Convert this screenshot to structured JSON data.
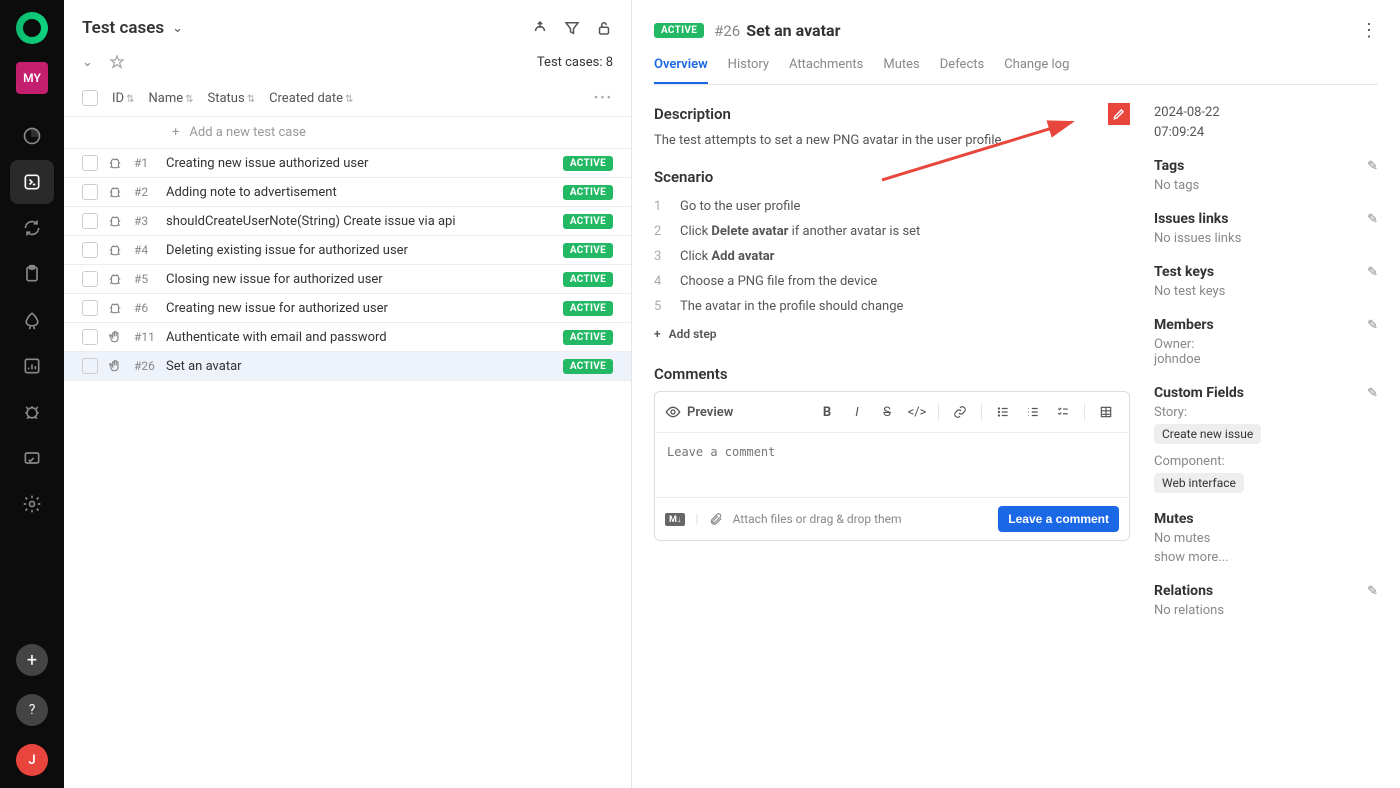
{
  "sidebar": {
    "my_badge": "MY",
    "user_initial": "J"
  },
  "left": {
    "title": "Test cases",
    "count_label": "Test cases: 8",
    "columns": {
      "id": "ID",
      "name": "Name",
      "status": "Status",
      "created": "Created date"
    },
    "add_placeholder": "Add a new test case",
    "rows": [
      {
        "id": "#1",
        "name": "Creating new issue authorized user",
        "status": "ACTIVE",
        "icon": "bug"
      },
      {
        "id": "#2",
        "name": "Adding note to advertisement",
        "status": "ACTIVE",
        "icon": "bug"
      },
      {
        "id": "#3",
        "name": "shouldCreateUserNote(String) Create issue via api",
        "status": "ACTIVE",
        "icon": "bug"
      },
      {
        "id": "#4",
        "name": "Deleting existing issue for authorized user",
        "status": "ACTIVE",
        "icon": "bug"
      },
      {
        "id": "#5",
        "name": "Closing new issue for authorized user",
        "status": "ACTIVE",
        "icon": "bug"
      },
      {
        "id": "#6",
        "name": "Creating new issue for authorized user",
        "status": "ACTIVE",
        "icon": "bug"
      },
      {
        "id": "#11",
        "name": "Authenticate with email and password",
        "status": "ACTIVE",
        "icon": "hand"
      },
      {
        "id": "#26",
        "name": "Set an avatar",
        "status": "ACTIVE",
        "icon": "hand"
      }
    ]
  },
  "detail": {
    "status": "ACTIVE",
    "id": "#26",
    "title": "Set an avatar",
    "tabs": [
      "Overview",
      "History",
      "Attachments",
      "Mutes",
      "Defects",
      "Change log"
    ],
    "description_h": "Description",
    "description": "The test attempts to set a new PNG avatar in the user profile",
    "scenario_h": "Scenario",
    "steps": [
      "Go to the user profile",
      "Click <b>Delete avatar</b> if another avatar is set",
      "Click <b>Add avatar</b>",
      "Choose a PNG file from the device",
      "The avatar in the profile should change"
    ],
    "add_step": "Add step",
    "comments_h": "Comments",
    "preview": "Preview",
    "comment_placeholder": "Leave a comment",
    "attach_text": "Attach files or drag & drop them",
    "leave_btn": "Leave a comment",
    "timestamp": "2024-08-22 07:09:24",
    "side": {
      "tags": {
        "title": "Tags",
        "text": "No tags"
      },
      "issues": {
        "title": "Issues links",
        "text": "No issues links"
      },
      "testkeys": {
        "title": "Test keys",
        "text": "No test keys"
      },
      "members": {
        "title": "Members",
        "label": "Owner:",
        "value": "johndoe"
      },
      "custom": {
        "title": "Custom Fields",
        "story_label": "Story:",
        "story_chip": "Create new issue",
        "component_label": "Component:",
        "component_chip": "Web interface"
      },
      "mutes": {
        "title": "Mutes",
        "text": "No mutes",
        "more": "show more..."
      },
      "relations": {
        "title": "Relations",
        "text": "No relations"
      }
    }
  }
}
